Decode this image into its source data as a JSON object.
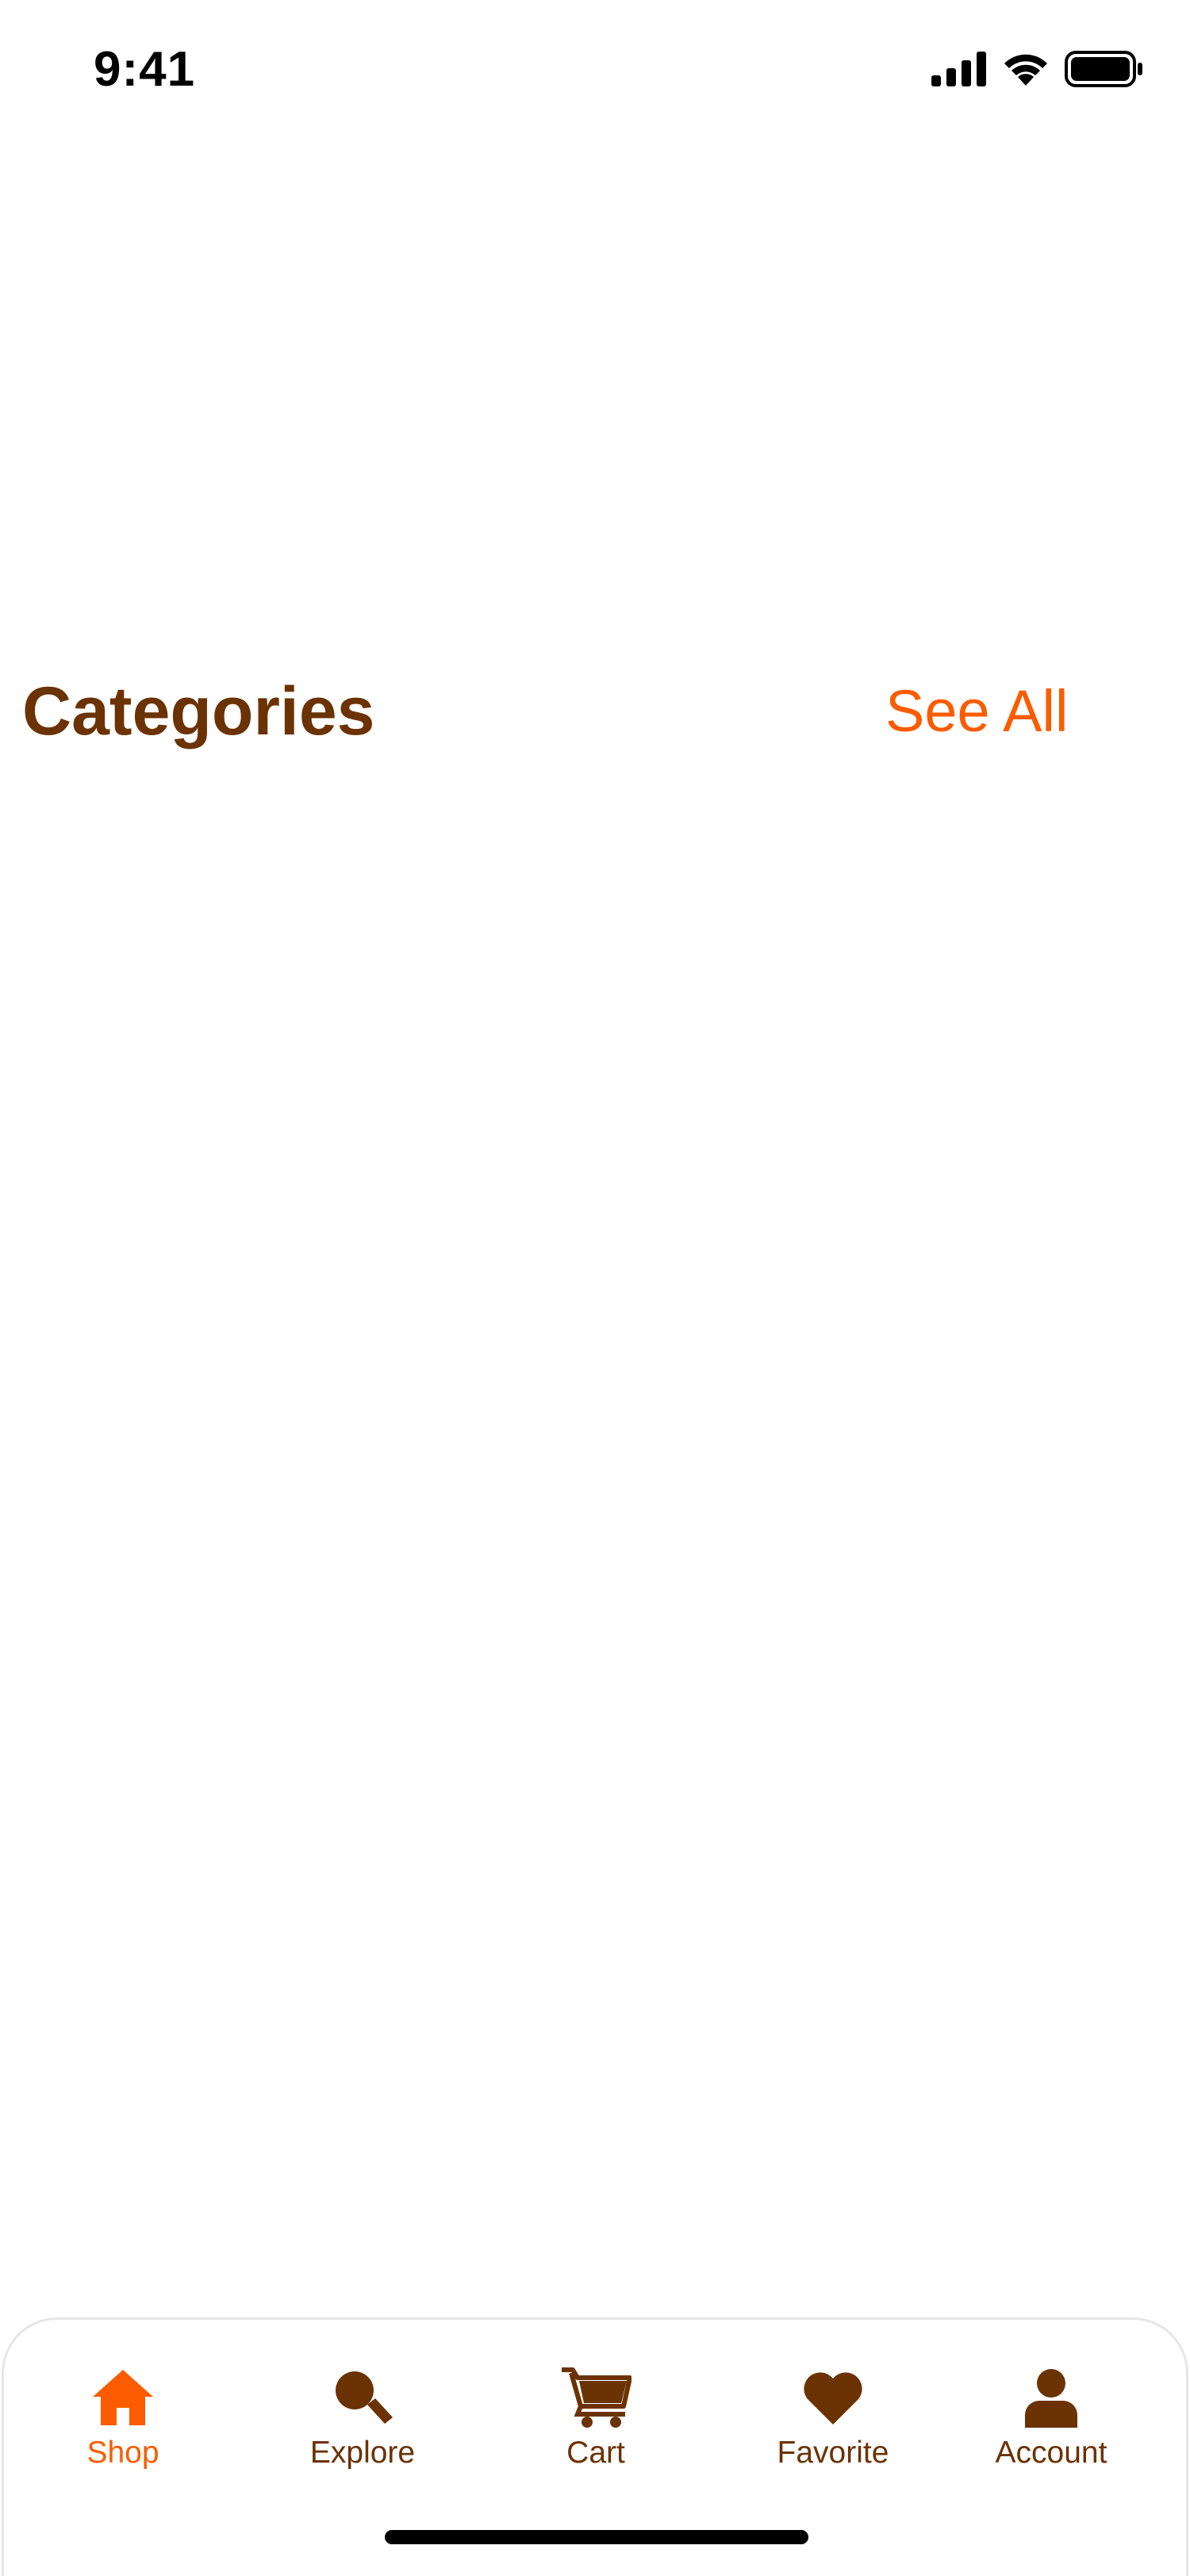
{
  "colors": {
    "brown": "#6b3203",
    "orange": "#fb5c00",
    "black": "#000000",
    "white": "#ffffff"
  },
  "status_bar": {
    "time": "9:41",
    "icons": [
      "cellular-signal-icon",
      "wifi-icon",
      "battery-icon"
    ]
  },
  "section": {
    "title": "Categories",
    "see_all": "See All"
  },
  "tab_bar": {
    "active": "Shop",
    "items": [
      {
        "label": "Shop",
        "icon": "home-icon"
      },
      {
        "label": "Explore",
        "icon": "search-icon"
      },
      {
        "label": "Cart",
        "icon": "cart-icon"
      },
      {
        "label": "Favorite",
        "icon": "heart-icon"
      },
      {
        "label": "Account",
        "icon": "user-icon"
      }
    ]
  }
}
